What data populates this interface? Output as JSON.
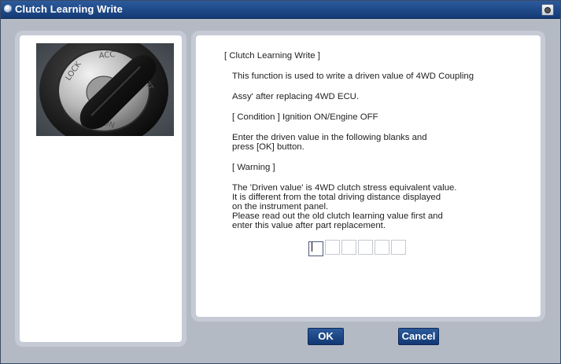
{
  "window": {
    "title": "Clutch Learning Write"
  },
  "content": {
    "heading": "[ Clutch Learning Write ]",
    "desc_line1": "This function is used to write a  driven value of 4WD Coupling",
    "desc_line2": "Assy' after replacing 4WD ECU.",
    "condition": "[ Condition ] Ignition ON/Engine OFF",
    "instr_line1": "Enter the driven value in the following blanks and",
    "instr_line2": "press [OK] button.",
    "warning_heading": "[ Warning ]",
    "warn_line1": "The 'Driven value' is 4WD clutch stress equivalent value.",
    "warn_line2": "It is different from the total driving distance displayed",
    "warn_line3": "on the instrument panel.",
    "warn_line4": "Please read out the old clutch learning value first and",
    "warn_line5": "enter this value after part replacement."
  },
  "input": {
    "digits": [
      "",
      "",
      "",
      "",
      "",
      ""
    ]
  },
  "buttons": {
    "ok": "OK",
    "cancel": "Cancel"
  },
  "icons": {
    "title": "window-icon",
    "capture": "camera-icon"
  }
}
